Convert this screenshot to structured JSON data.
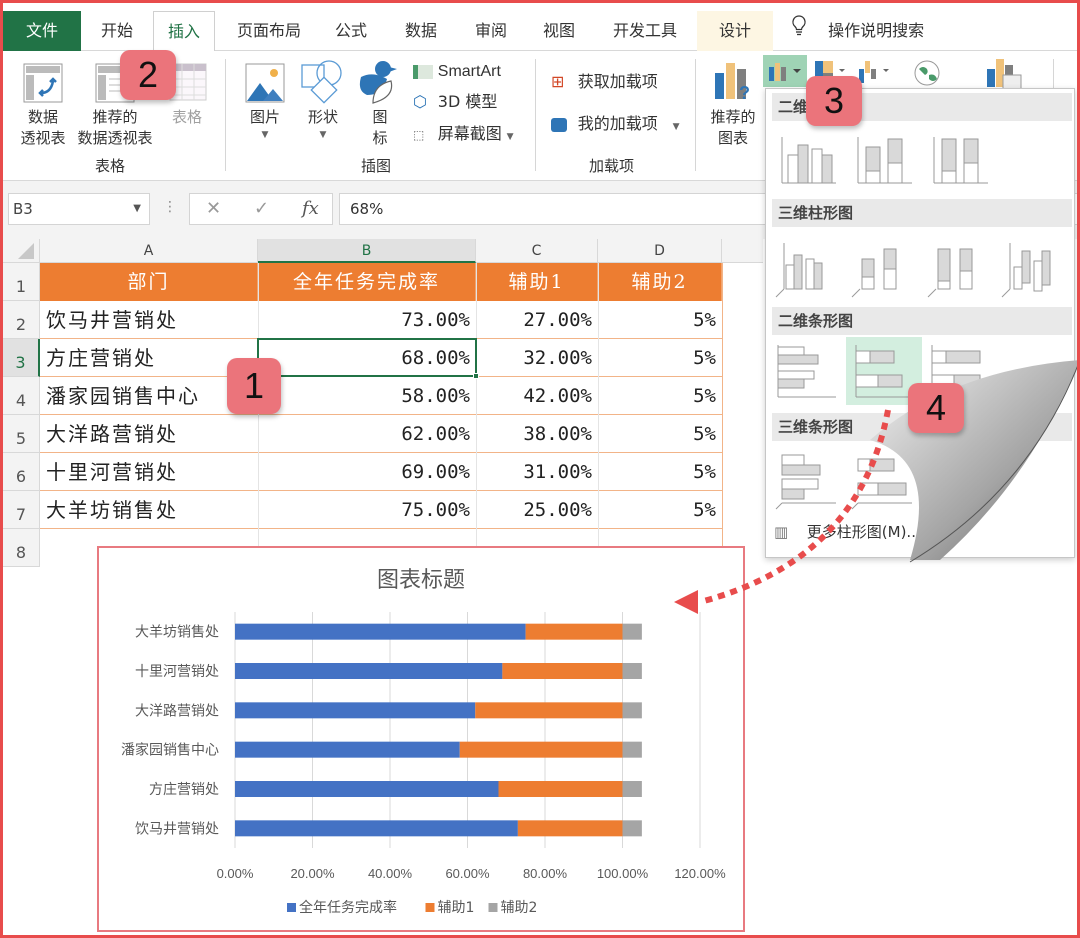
{
  "ribbon_tabs": [
    "文件",
    "开始",
    "插入",
    "页面布局",
    "公式",
    "数据",
    "审阅",
    "视图",
    "开发工具",
    "设计"
  ],
  "active_tab": "插入",
  "search": {
    "label": "操作说明搜索"
  },
  "ribbon": {
    "tables_group": {
      "name": "表格",
      "pivot_table": [
        "数据",
        "透视表"
      ],
      "recommended_pivot": [
        "推荐的",
        "数据透视表"
      ],
      "table": "表格"
    },
    "illustrations_group": {
      "name": "插图",
      "pictures": "图片",
      "shapes": "形状",
      "icons": [
        "图",
        "标"
      ],
      "smartart": "SmartArt",
      "model3d": "3D 模型",
      "screenshot": "屏幕截图"
    },
    "addins_group": {
      "name": "加载项",
      "get_addins": "获取加载项",
      "my_addins": "我的加载项"
    },
    "charts_group": {
      "recommended_charts": [
        "推荐的",
        "图表"
      ]
    }
  },
  "formula_bar": {
    "name_box": "B3",
    "cancel": "✕",
    "enter": "✓",
    "fx": "fx",
    "value": "68%"
  },
  "sheet": {
    "columns": [
      "A",
      "B",
      "C",
      "D"
    ],
    "rows": [
      "1",
      "2",
      "3",
      "4",
      "5",
      "6",
      "7",
      "8"
    ],
    "header": [
      "部门",
      "全年任务完成率",
      "辅助1",
      "辅助2"
    ],
    "data": [
      [
        "饮马井营销处",
        "73.00%",
        "27.00%",
        "5%"
      ],
      [
        "方庄营销处",
        "68.00%",
        "32.00%",
        "5%"
      ],
      [
        "潘家园销售中心",
        "58.00%",
        "42.00%",
        "5%"
      ],
      [
        "大洋路营销处",
        "62.00%",
        "38.00%",
        "5%"
      ],
      [
        "十里河营销处",
        "69.00%",
        "31.00%",
        "5%"
      ],
      [
        "大羊坊销售处",
        "75.00%",
        "25.00%",
        "5%"
      ]
    ],
    "selected_cell": "B3"
  },
  "chart_dropdown": {
    "sections": [
      "二维柱形图",
      "三维柱形图",
      "二维条形图",
      "三维条形图"
    ],
    "more": "更多柱形图(M)..."
  },
  "badges": [
    "1",
    "2",
    "3",
    "4"
  ],
  "colors": {
    "excel_green": "#217346",
    "header_orange": "#ed7d31",
    "series_blue": "#4472c4",
    "series_orange": "#ed7d31",
    "series_gray": "#a5a5a5",
    "badge": "#eb747b",
    "annotation_red": "#e84c4c"
  },
  "chart_data": {
    "type": "bar",
    "orientation": "horizontal",
    "stacked": true,
    "title": "图表标题",
    "categories": [
      "饮马井营销处",
      "方庄营销处",
      "潘家园销售中心",
      "大洋路营销处",
      "十里河营销处",
      "大羊坊销售处"
    ],
    "series": [
      {
        "name": "全年任务完成率",
        "values": [
          0.73,
          0.68,
          0.58,
          0.62,
          0.69,
          0.75
        ]
      },
      {
        "name": "辅助1",
        "values": [
          0.27,
          0.32,
          0.42,
          0.38,
          0.31,
          0.25
        ]
      },
      {
        "name": "辅助2",
        "values": [
          0.05,
          0.05,
          0.05,
          0.05,
          0.05,
          0.05
        ]
      }
    ],
    "xlim": [
      0,
      1.2
    ],
    "xticks": [
      "0.00%",
      "20.00%",
      "40.00%",
      "60.00%",
      "80.00%",
      "100.00%",
      "120.00%"
    ],
    "grid": true,
    "legend": "bottom",
    "xlabel": "",
    "ylabel": ""
  }
}
